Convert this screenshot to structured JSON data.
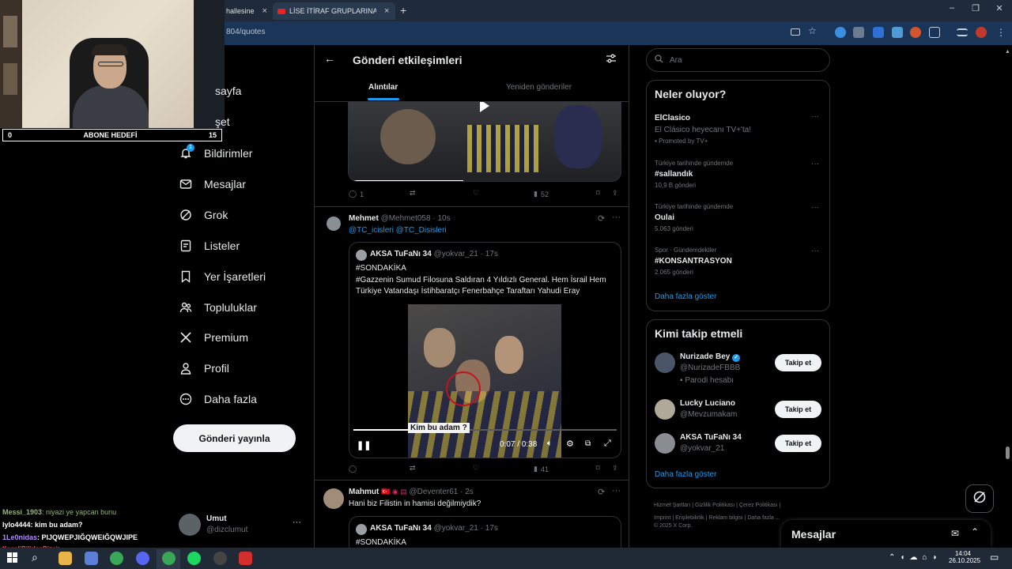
{
  "browser": {
    "tabs": [
      {
        "title": "hallesine",
        "close": "×"
      },
      {
        "title": "LİSE İTİRAF GRUPLARINA SIZD",
        "close": "×"
      }
    ],
    "new_tab": "+",
    "url": "804/quotes",
    "window_controls": [
      "–",
      "❐",
      "✕"
    ]
  },
  "stream": {
    "goal_label": "ABONE HEDEFİ",
    "goal_current": "0",
    "goal_target": "15",
    "chat": [
      {
        "user": "Messi_1903",
        "msg": ": niyazi ye yapcan bunu",
        "color": "#9ab37c"
      },
      {
        "user": "lylo4444",
        "msg": ": kim bu adam?",
        "color": "#ffffff"
      },
      {
        "user": "1Le0nidas",
        "msg": ": PIJQWEPJIĞQWEIĞQWJIPE",
        "color": "#b48cff"
      },
      {
        "user": "KanaliBilirlenDizci",
        "msg": ":",
        "color": "#ff5a5a"
      }
    ]
  },
  "sidebar": {
    "items": [
      {
        "label": "sayfa",
        "icon": "home-icon"
      },
      {
        "label": "şet",
        "icon": "explore-icon"
      },
      {
        "label": "Bildirimler",
        "icon": "bell-icon",
        "badge": "1"
      },
      {
        "label": "Mesajlar",
        "icon": "mail-icon"
      },
      {
        "label": "Grok",
        "icon": "grok-icon"
      },
      {
        "label": "Listeler",
        "icon": "list-icon"
      },
      {
        "label": "Yer İşaretleri",
        "icon": "bookmark-icon"
      },
      {
        "label": "Topluluklar",
        "icon": "people-icon"
      },
      {
        "label": "Premium",
        "icon": "x-logo-icon"
      },
      {
        "label": "Profil",
        "icon": "person-icon"
      },
      {
        "label": "Daha fazla",
        "icon": "more-circle-icon"
      }
    ],
    "post_button": "Gönderi yayınla",
    "account": {
      "name": "Umut",
      "handle": "@dizclumut",
      "more": "···"
    }
  },
  "main": {
    "title": "Gönderi etkileşimleri",
    "tabs": [
      {
        "label": "Alıntılar",
        "active": true
      },
      {
        "label": "Yeniden gönderiler",
        "active": false
      }
    ],
    "top_post_actions": {
      "replies": "1",
      "views": "52"
    },
    "post1": {
      "name": "Mehmet",
      "handle": "@Mehmet058",
      "time": "10s",
      "mentions": "@TC_icisleri @TC_Disisleri",
      "quote": {
        "name": "AKSA TuFaNı 34",
        "handle": "@yokvar_21",
        "time": "17s",
        "line1": "#SONDAKİKA",
        "line2": "#Gazzenin Sumud Filosuna Saldıran 4 Yıldızlı General. Hem İsrail Hem Türkiye Vatandaşı İstihbaratçı Fenerbahçe Taraftarı Yahudi Eray",
        "video_caption": "Kim bu adam ?",
        "video_time": "0:07 / 0:38"
      },
      "views": "41"
    },
    "post2": {
      "name": "Mahmut",
      "handle": "@Deventer61",
      "time": "2s",
      "text": "Hani biz Filistin in hamisi değilmiydik?",
      "quote": {
        "name": "AKSA TuFaNı 34",
        "handle": "@yokvar_21",
        "time": "17s",
        "line1": "#SONDAKİKA"
      }
    }
  },
  "right": {
    "search_placeholder": "Ara",
    "trends_title": "Neler oluyor?",
    "trends": [
      {
        "context": "",
        "name": "ElClasico",
        "sub": "El Clásico heyecanı TV+'ta!",
        "meta": "Promoted by TV+"
      },
      {
        "context": "Türkiye tarihinde gündemde",
        "name": "#sallandık",
        "sub": "",
        "meta": "10,9 B gönderi"
      },
      {
        "context": "Türkiye tarihinde gündemde",
        "name": "Oulai",
        "sub": "",
        "meta": "5.063 gönderi"
      },
      {
        "context": "Spor · Gündemdekiler",
        "name": "#KONSANTRASYON",
        "sub": "",
        "meta": "2.065 gönderi"
      }
    ],
    "show_more": "Daha fazla göster",
    "who_title": "Kimi takip etmeli",
    "who": [
      {
        "name": "Nurizade Bey",
        "handle": "@NurizadeFBBB",
        "note": "Parodi hesabı",
        "btn": "Takip et"
      },
      {
        "name": "Lucky Luciano",
        "handle": "@Mevzumakam",
        "note": "",
        "btn": "Takip et"
      },
      {
        "name": "AKSA TuFaNı 34",
        "handle": "@yokvar_21",
        "note": "",
        "btn": "Takip et"
      }
    ],
    "who_more": "Daha fazla göster",
    "footer": [
      "Hizmet Şartları",
      "Gizlilik Politikası",
      "Çerez Politikası",
      "Imprint",
      "Erişilebilirlik",
      "Reklam bilgisi",
      "Daha fazla ..."
    ],
    "copyright": "© 2025 X Corp.",
    "messages_dock": "Mesajlar"
  },
  "taskbar": {
    "time": "14:04",
    "date": "26.10.2025"
  }
}
